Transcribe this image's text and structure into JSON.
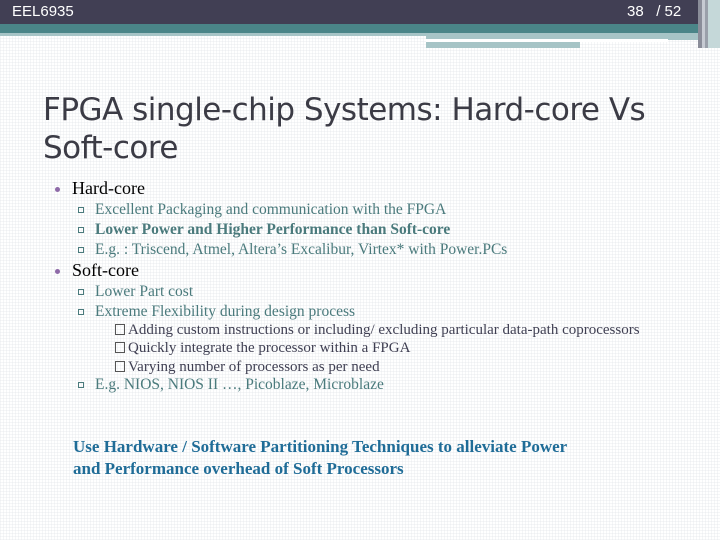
{
  "header": {
    "course_code": "EEL6935",
    "page_current": "38",
    "page_total": "/ 52"
  },
  "colors": {
    "header_bg": "#413f54",
    "teal_band": "#4a8588",
    "bullet_dot": "#8e6aa8",
    "sub_text": "#4a7a7c",
    "conclusion_text": "#1f6c97"
  },
  "slide": {
    "title": "FPGA single-chip Systems: Hard-core Vs Soft-core",
    "sections": [
      {
        "label": "Hard-core",
        "items": [
          {
            "text": "Excellent Packaging  and communication with the FPGA",
            "bold": false
          },
          {
            "text": "Lower Power and Higher Performance than Soft-core",
            "bold": true
          },
          {
            "text": "E.g. : Triscend, Atmel, Altera’s Excalibur, Virtex* with Power.PCs",
            "bold": false
          }
        ]
      },
      {
        "label": "Soft-core",
        "items": [
          {
            "text": "Lower Part cost"
          },
          {
            "text": "Extreme Flexibility during design process"
          },
          {
            "text": "E.g. NIOS, NIOS II …, Picoblaze, Microblaze"
          }
        ],
        "subitems": [
          "Adding custom instructions or including/ excluding particular data-path coprocessors",
          "Quickly integrate the processor within a FPGA",
          "Varying number of processors as per need"
        ]
      }
    ],
    "conclusion": "Use Hardware / Software Partitioning Techniques to alleviate Power and Performance overhead of Soft Processors"
  }
}
